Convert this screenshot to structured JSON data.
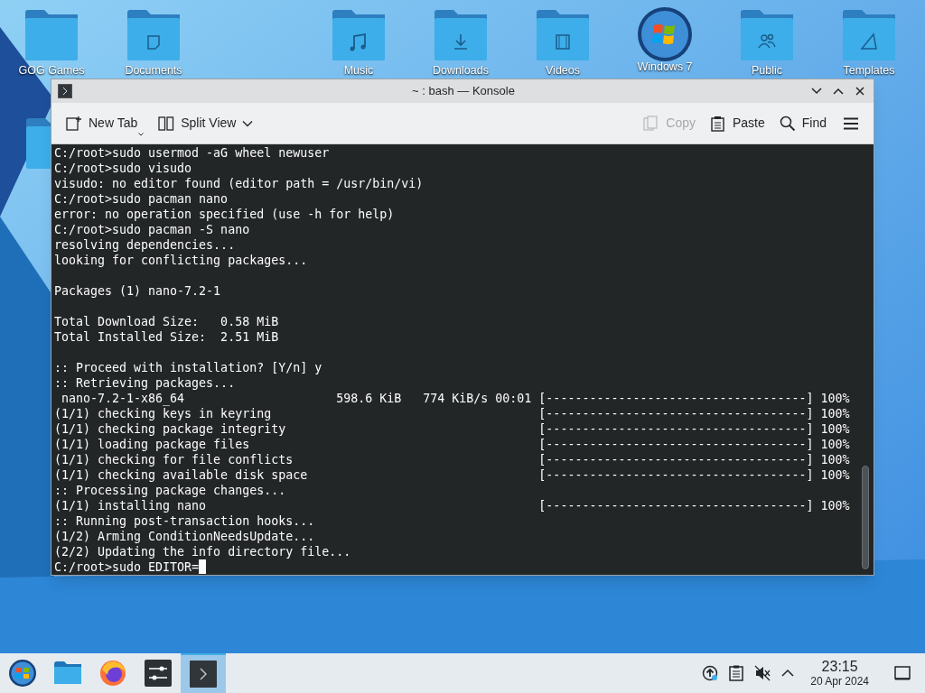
{
  "desktop": {
    "icons": [
      {
        "kind": "folder",
        "label": "GOG Games"
      },
      {
        "kind": "documents",
        "label": "Documents"
      },
      {
        "kind": "music",
        "label": "Music"
      },
      {
        "kind": "downloads",
        "label": "Downloads"
      },
      {
        "kind": "videos",
        "label": "Videos"
      },
      {
        "kind": "orb",
        "label": "Windows 7"
      },
      {
        "kind": "public",
        "label": "Public"
      },
      {
        "kind": "templates",
        "label": "Templates"
      },
      {
        "kind": "folder"
      }
    ]
  },
  "window": {
    "title": "~ : bash — Konsole",
    "toolbar": [
      {
        "kind": "new-tab",
        "label": "New Tab",
        "disabled": false
      },
      {
        "kind": "split-view",
        "label": "Split View",
        "disabled": false
      },
      {
        "kind": "copy",
        "label": "Copy",
        "disabled": true
      },
      {
        "kind": "paste",
        "label": "Paste",
        "disabled": false
      },
      {
        "kind": "find",
        "label": "Find",
        "disabled": false
      }
    ]
  },
  "terminal": {
    "lines": [
      {
        "kind": "text",
        "text": "C:/root>sudo usermod -aG wheel newuser"
      },
      {
        "kind": "text",
        "text": "C:/root>sudo visudo"
      },
      {
        "kind": "text",
        "text": "visudo: no editor found (editor path = /usr/bin/vi)"
      },
      {
        "kind": "text",
        "text": "C:/root>sudo pacman nano"
      },
      {
        "kind": "text",
        "text": "error: no operation specified (use -h for help)"
      },
      {
        "kind": "text",
        "text": "C:/root>sudo pacman -S nano"
      },
      {
        "kind": "text",
        "text": "resolving dependencies..."
      },
      {
        "kind": "text",
        "text": "looking for conflicting packages..."
      },
      {
        "kind": "blank"
      },
      {
        "kind": "text",
        "text": "Packages (1) nano-7.2-1"
      },
      {
        "kind": "blank"
      },
      {
        "kind": "text",
        "text": "Total Download Size:   0.58 MiB"
      },
      {
        "kind": "text",
        "text": "Total Installed Size:  2.51 MiB"
      },
      {
        "kind": "blank"
      },
      {
        "kind": "text",
        "text": ":: Proceed with installation? [Y/n] y"
      },
      {
        "kind": "text",
        "text": ":: Retrieving packages..."
      },
      {
        "kind": "text",
        "text": " nano-7.2-1-x86_64                     598.6 KiB   774 KiB/s 00:01 [------------------------------------] 100%"
      },
      {
        "kind": "text",
        "text": "(1/1) checking keys in keyring                                     [------------------------------------] 100%"
      },
      {
        "kind": "text",
        "text": "(1/1) checking package integrity                                   [------------------------------------] 100%"
      },
      {
        "kind": "text",
        "text": "(1/1) loading package files                                        [------------------------------------] 100%"
      },
      {
        "kind": "text",
        "text": "(1/1) checking for file conflicts                                  [------------------------------------] 100%"
      },
      {
        "kind": "text",
        "text": "(1/1) checking available disk space                                [------------------------------------] 100%"
      },
      {
        "kind": "text",
        "text": ":: Processing package changes..."
      },
      {
        "kind": "text",
        "text": "(1/1) installing nano                                              [------------------------------------] 100%"
      },
      {
        "kind": "text",
        "text": ":: Running post-transaction hooks..."
      },
      {
        "kind": "text",
        "text": "(1/2) Arming ConditionNeedsUpdate..."
      },
      {
        "kind": "text",
        "text": "(2/2) Updating the info directory file..."
      },
      {
        "kind": "prompt",
        "text": "C:/root>sudo EDITOR="
      }
    ]
  },
  "taskbar": {
    "apps": [
      {
        "kind": "start",
        "selected": false
      },
      {
        "kind": "files",
        "selected": false
      },
      {
        "kind": "browser",
        "selected": false
      },
      {
        "kind": "mixer",
        "selected": false
      },
      {
        "kind": "terminal",
        "selected": true
      }
    ],
    "clock": {
      "time": "23:15",
      "date": "20 Apr 2024"
    }
  }
}
